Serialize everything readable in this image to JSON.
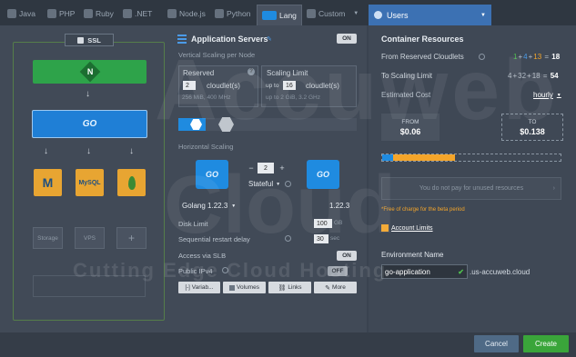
{
  "tabs": [
    {
      "label": "Java"
    },
    {
      "label": "PHP"
    },
    {
      "label": "Ruby"
    },
    {
      "label": ".NET"
    },
    {
      "label": "Node.js"
    },
    {
      "label": "Python"
    },
    {
      "label": "Lang"
    },
    {
      "label": "Custom"
    }
  ],
  "users_label": "Users",
  "topology": {
    "ssl_label": "SSL",
    "nginx_letter": "N",
    "mysql_label": "MySQL",
    "storage_label": "Storage",
    "vps_label": "VPS",
    "add_symbol": "+"
  },
  "app_servers": {
    "title": "Application Servers",
    "toggle": "ON",
    "vertical_label": "Vertical Scaling per Node",
    "reserved_title": "Reserved",
    "reserved_value": "2",
    "reserved_unit": "cloudlet(s)",
    "reserved_sub": "256 MiB, 400 MHz",
    "limit_title": "Scaling Limit",
    "limit_prefix": "up to",
    "limit_value": "16",
    "limit_unit": "cloudlet(s)",
    "limit_sub": "up to 2 GiB, 3.2 GHz",
    "horizontal_label": "Horizontal Scaling",
    "node_count": "2",
    "minus": "−",
    "plus": "+",
    "stateful": "Stateful",
    "golang_left": "Golang 1.22.3",
    "golang_right": "1.22.3",
    "disk_label": "Disk Limit",
    "disk_value": "100",
    "disk_unit": "GB",
    "restart_label": "Sequential restart delay",
    "restart_value": "30",
    "restart_unit": "sec",
    "slb_label": "Access via SLB",
    "slb_toggle": "ON",
    "ipv4_label": "Public IPv4",
    "ipv4_toggle": "OFF",
    "btn_variables": "Variab...",
    "btn_volumes": "Volumes",
    "btn_links": "Links",
    "btn_more": "More",
    "go_logo": "GO"
  },
  "resources": {
    "title": "Container Resources",
    "from_label": "From Reserved Cloudlets",
    "from_a": "1",
    "from_b": "4",
    "from_c": "13",
    "from_total": "18",
    "to_label": "To Scaling Limit",
    "to_a": "4",
    "to_b": "32",
    "to_c": "18",
    "to_total": "54",
    "cost_label": "Estimated Cost",
    "cost_period": "hourly",
    "from_box_label": "FROM",
    "from_price": "$0.06",
    "to_box_label": "TO",
    "to_price": "$0.138",
    "unused_text": "You do not pay for unused resources",
    "beta_text": "*Free of charge for the beta period",
    "limits_link": "Account Limits",
    "env_label": "Environment Name",
    "env_value": "go-application",
    "env_domain": ".us-accuweb.cloud",
    "colors": {
      "green": "#4fc04f",
      "blue": "#4b9be8",
      "orange": "#f4a52a"
    }
  },
  "footer": {
    "cancel": "Cancel",
    "create": "Create"
  },
  "watermark": {
    "line1": "Accu",
    "line2": "web",
    "line3": "Cloud",
    "tagline": "Cutting Edge Cloud Hosting"
  }
}
